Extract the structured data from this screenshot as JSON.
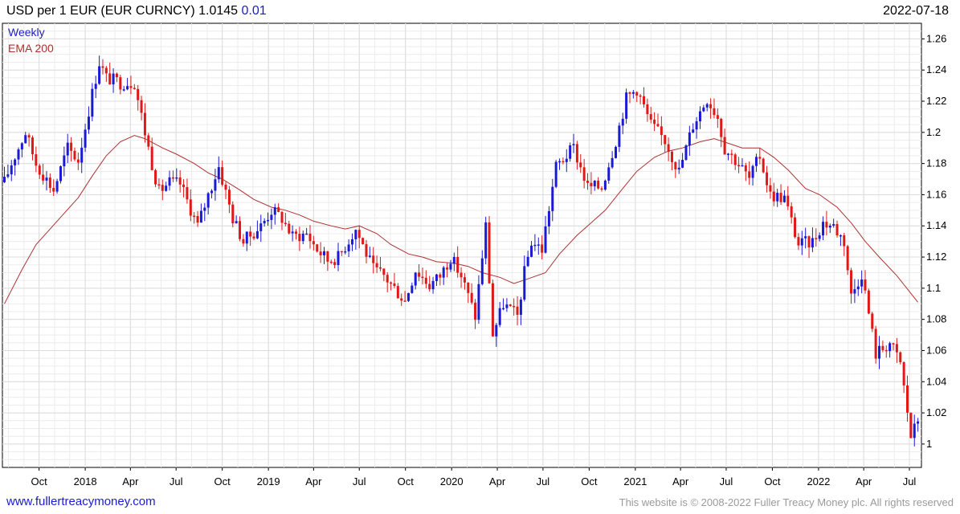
{
  "header": {
    "title": "USD per 1 EUR (EUR CURNCY) 1.0145",
    "change": "0.01",
    "date": "2022-07-18"
  },
  "footer": {
    "link": "www.fullertreacymoney.com",
    "copyright": "This website is © 2008-2022 Fuller Treacy Money plc. All rights reserved"
  },
  "colors": {
    "up": "#1a1ad6",
    "down": "#e01818",
    "ema": "#b03030",
    "grid": "#dcdcdc"
  },
  "chart_data": {
    "type": "candlestick",
    "legend": [
      "Weekly",
      "EMA 200"
    ],
    "legend_position": "top-left",
    "grid": true,
    "y_axis_side": "right",
    "ylim": [
      0.985,
      1.27
    ],
    "yticks": [
      1,
      1.02,
      1.04,
      1.06,
      1.08,
      1.1,
      1.12,
      1.14,
      1.16,
      1.18,
      1.2,
      1.22,
      1.24,
      1.26
    ],
    "xlim": [
      "2017-07-20",
      "2022-07-25"
    ],
    "xticks": [
      {
        "label": "Oct",
        "date": "2017-10-01"
      },
      {
        "label": "2018",
        "date": "2018-01-01"
      },
      {
        "label": "Apr",
        "date": "2018-04-01"
      },
      {
        "label": "Jul",
        "date": "2018-07-01"
      },
      {
        "label": "Oct",
        "date": "2018-10-01"
      },
      {
        "label": "2019",
        "date": "2019-01-01"
      },
      {
        "label": "Apr",
        "date": "2019-04-01"
      },
      {
        "label": "Jul",
        "date": "2019-07-01"
      },
      {
        "label": "Oct",
        "date": "2019-10-01"
      },
      {
        "label": "2020",
        "date": "2020-01-01"
      },
      {
        "label": "Apr",
        "date": "2020-04-01"
      },
      {
        "label": "Jul",
        "date": "2020-07-01"
      },
      {
        "label": "Oct",
        "date": "2020-10-01"
      },
      {
        "label": "2021",
        "date": "2021-01-01"
      },
      {
        "label": "Apr",
        "date": "2021-04-01"
      },
      {
        "label": "Jul",
        "date": "2021-07-01"
      },
      {
        "label": "Oct",
        "date": "2021-10-01"
      },
      {
        "label": "2022",
        "date": "2022-01-01"
      },
      {
        "label": "Apr",
        "date": "2022-04-01"
      },
      {
        "label": "Jul",
        "date": "2022-07-01"
      }
    ],
    "price_path": [
      [
        "2017-07-24",
        1.168
      ],
      [
        "2017-08-07",
        1.18
      ],
      [
        "2017-09-04",
        1.2
      ],
      [
        "2017-09-25",
        1.18
      ],
      [
        "2017-10-30",
        1.163
      ],
      [
        "2017-11-27",
        1.19
      ],
      [
        "2017-12-18",
        1.182
      ],
      [
        "2018-01-15",
        1.225
      ],
      [
        "2018-01-29",
        1.245
      ],
      [
        "2018-02-12",
        1.235
      ],
      [
        "2018-03-12",
        1.232
      ],
      [
        "2018-04-09",
        1.232
      ],
      [
        "2018-04-30",
        1.2
      ],
      [
        "2018-05-14",
        1.18
      ],
      [
        "2018-05-28",
        1.162
      ],
      [
        "2018-06-18",
        1.168
      ],
      [
        "2018-07-09",
        1.167
      ],
      [
        "2018-08-13",
        1.14
      ],
      [
        "2018-09-03",
        1.16
      ],
      [
        "2018-09-24",
        1.178
      ],
      [
        "2018-10-22",
        1.145
      ],
      [
        "2018-11-12",
        1.13
      ],
      [
        "2018-12-17",
        1.14
      ],
      [
        "2019-01-07",
        1.15
      ],
      [
        "2019-01-28",
        1.145
      ],
      [
        "2019-02-18",
        1.133
      ],
      [
        "2019-03-18",
        1.135
      ],
      [
        "2019-04-08",
        1.125
      ],
      [
        "2019-04-29",
        1.118
      ],
      [
        "2019-05-20",
        1.12
      ],
      [
        "2019-06-24",
        1.138
      ],
      [
        "2019-07-29",
        1.112
      ],
      [
        "2019-08-19",
        1.108
      ],
      [
        "2019-09-09",
        1.1
      ],
      [
        "2019-09-30",
        1.092
      ],
      [
        "2019-10-21",
        1.112
      ],
      [
        "2019-11-18",
        1.102
      ],
      [
        "2019-12-09",
        1.108
      ],
      [
        "2019-12-30",
        1.12
      ],
      [
        "2020-01-20",
        1.108
      ],
      [
        "2020-02-17",
        1.082
      ],
      [
        "2020-03-09",
        1.14
      ],
      [
        "2020-03-23",
        1.07
      ],
      [
        "2020-04-13",
        1.09
      ],
      [
        "2020-05-11",
        1.082
      ],
      [
        "2020-05-25",
        1.11
      ],
      [
        "2020-06-08",
        1.13
      ],
      [
        "2020-06-29",
        1.125
      ],
      [
        "2020-07-27",
        1.178
      ],
      [
        "2020-08-31",
        1.19
      ],
      [
        "2020-09-28",
        1.165
      ],
      [
        "2020-10-26",
        1.165
      ],
      [
        "2020-11-23",
        1.195
      ],
      [
        "2020-12-14",
        1.222
      ],
      [
        "2021-01-04",
        1.228
      ],
      [
        "2021-02-01",
        1.205
      ],
      [
        "2021-03-01",
        1.195
      ],
      [
        "2021-03-29",
        1.175
      ],
      [
        "2021-04-26",
        1.205
      ],
      [
        "2021-05-24",
        1.222
      ],
      [
        "2021-06-14",
        1.21
      ],
      [
        "2021-06-28",
        1.19
      ],
      [
        "2021-07-26",
        1.18
      ],
      [
        "2021-08-16",
        1.17
      ],
      [
        "2021-09-06",
        1.185
      ],
      [
        "2021-09-27",
        1.16
      ],
      [
        "2021-10-25",
        1.158
      ],
      [
        "2021-11-22",
        1.128
      ],
      [
        "2021-12-20",
        1.13
      ],
      [
        "2022-01-10",
        1.142
      ],
      [
        "2022-01-31",
        1.14
      ],
      [
        "2022-02-21",
        1.13
      ],
      [
        "2022-03-07",
        1.095
      ],
      [
        "2022-03-28",
        1.11
      ],
      [
        "2022-04-25",
        1.058
      ],
      [
        "2022-05-23",
        1.065
      ],
      [
        "2022-06-13",
        1.052
      ],
      [
        "2022-07-04",
        1.005
      ],
      [
        "2022-07-18",
        1.0145
      ]
    ],
    "ema200_path": [
      [
        "2017-07-24",
        1.09
      ],
      [
        "2017-08-28",
        1.112
      ],
      [
        "2017-09-25",
        1.128
      ],
      [
        "2017-10-23",
        1.138
      ],
      [
        "2017-11-20",
        1.148
      ],
      [
        "2017-12-18",
        1.158
      ],
      [
        "2018-01-15",
        1.172
      ],
      [
        "2018-02-12",
        1.185
      ],
      [
        "2018-03-12",
        1.194
      ],
      [
        "2018-04-09",
        1.198
      ],
      [
        "2018-04-30",
        1.196
      ],
      [
        "2018-06-04",
        1.19
      ],
      [
        "2018-07-02",
        1.186
      ],
      [
        "2018-08-06",
        1.18
      ],
      [
        "2018-09-03",
        1.174
      ],
      [
        "2018-10-01",
        1.17
      ],
      [
        "2018-11-05",
        1.163
      ],
      [
        "2018-12-03",
        1.157
      ],
      [
        "2019-01-07",
        1.152
      ],
      [
        "2019-02-04",
        1.15
      ],
      [
        "2019-03-04",
        1.147
      ],
      [
        "2019-04-01",
        1.143
      ],
      [
        "2019-05-06",
        1.14
      ],
      [
        "2019-06-03",
        1.138
      ],
      [
        "2019-07-01",
        1.14
      ],
      [
        "2019-08-05",
        1.135
      ],
      [
        "2019-09-02",
        1.128
      ],
      [
        "2019-10-07",
        1.122
      ],
      [
        "2019-11-04",
        1.12
      ],
      [
        "2019-12-02",
        1.117
      ],
      [
        "2020-01-06",
        1.116
      ],
      [
        "2020-02-03",
        1.114
      ],
      [
        "2020-03-02",
        1.11
      ],
      [
        "2020-04-06",
        1.107
      ],
      [
        "2020-05-04",
        1.103
      ],
      [
        "2020-06-01",
        1.106
      ],
      [
        "2020-07-06",
        1.11
      ],
      [
        "2020-08-03",
        1.122
      ],
      [
        "2020-09-07",
        1.134
      ],
      [
        "2020-10-05",
        1.142
      ],
      [
        "2020-11-02",
        1.15
      ],
      [
        "2020-12-07",
        1.164
      ],
      [
        "2021-01-04",
        1.175
      ],
      [
        "2021-02-08",
        1.184
      ],
      [
        "2021-03-08",
        1.188
      ],
      [
        "2021-04-05",
        1.19
      ],
      [
        "2021-05-10",
        1.194
      ],
      [
        "2021-06-07",
        1.196
      ],
      [
        "2021-07-05",
        1.193
      ],
      [
        "2021-08-02",
        1.19
      ],
      [
        "2021-09-06",
        1.19
      ],
      [
        "2021-10-04",
        1.184
      ],
      [
        "2021-11-01",
        1.176
      ],
      [
        "2021-12-06",
        1.164
      ],
      [
        "2022-01-03",
        1.16
      ],
      [
        "2022-02-07",
        1.152
      ],
      [
        "2022-03-07",
        1.142
      ],
      [
        "2022-04-04",
        1.13
      ],
      [
        "2022-05-02",
        1.12
      ],
      [
        "2022-06-06",
        1.108
      ],
      [
        "2022-07-18",
        1.091
      ]
    ]
  }
}
